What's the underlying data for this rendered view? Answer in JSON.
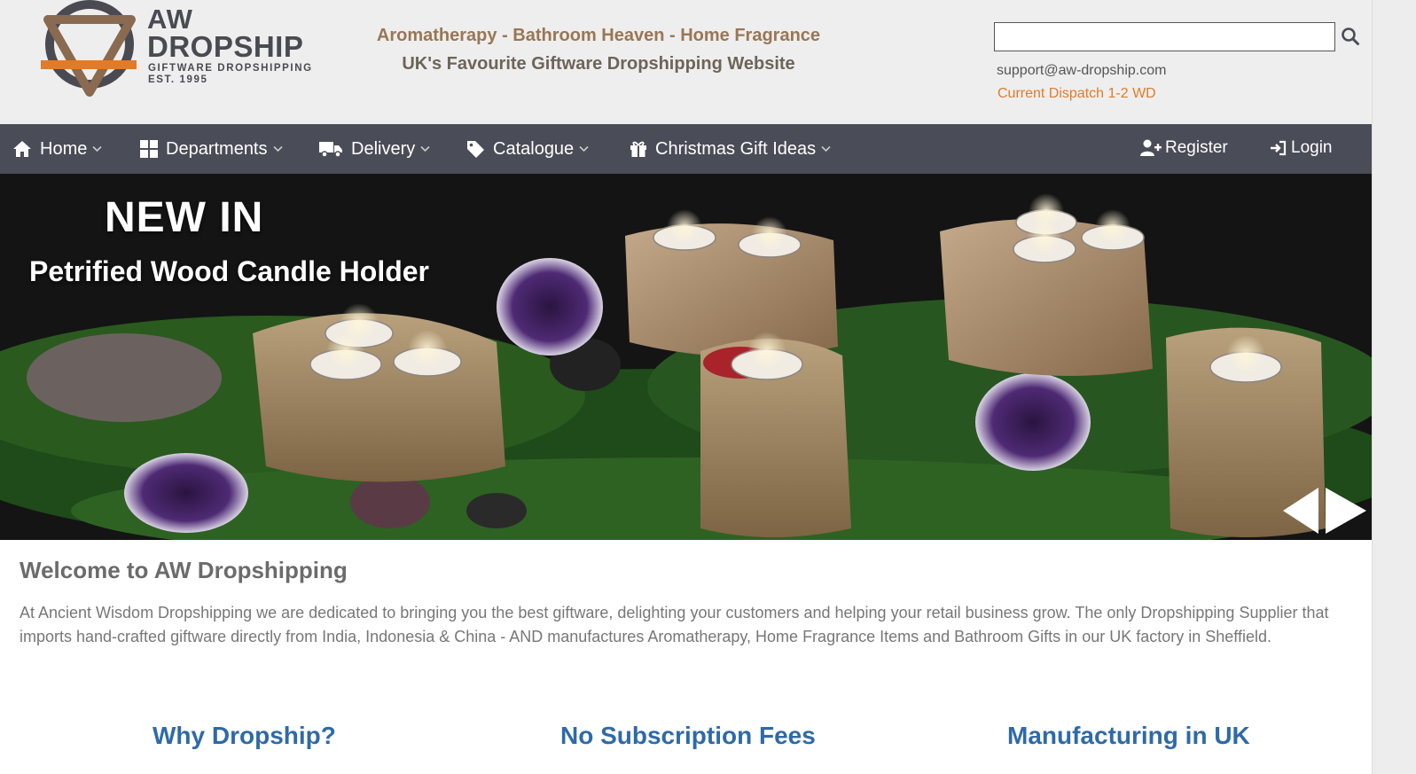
{
  "header": {
    "logo": {
      "line1": "AW",
      "line2": "DROPSHIP",
      "line3": "GIFTWARE DROPSHIPPING",
      "line4": "EST. 1995"
    },
    "tagline_1": "Aromatherapy - Bathroom Heaven - Home Fragrance",
    "tagline_2": "UK's Favourite Giftware Dropshipping Website",
    "search": {
      "value": "",
      "placeholder": ""
    },
    "support_email": "support@aw-dropship.com",
    "dispatch": "Current Dispatch 1-2 WD"
  },
  "nav": {
    "items": [
      {
        "label": "Home",
        "icon": "home-icon"
      },
      {
        "label": "Departments",
        "icon": "grid-icon"
      },
      {
        "label": "Delivery",
        "icon": "truck-icon"
      },
      {
        "label": "Catalogue",
        "icon": "tag-icon"
      },
      {
        "label": "Christmas Gift Ideas",
        "icon": "gift-icon"
      }
    ],
    "register": "Register",
    "login": "Login"
  },
  "banner": {
    "title": "NEW IN",
    "subtitle": "Petrified Wood Candle Holder"
  },
  "content": {
    "welcome_title": "Welcome to AW Dropshipping",
    "welcome_text": "At Ancient Wisdom Dropshipping we are dedicated to bringing you the best giftware, delighting your customers and helping your retail business grow. The only  Dropshipping Supplier that imports hand-crafted giftware directly from India, Indonesia & China - AND manufactures Aromatherapy, Home Fragrance Items and Bathroom Gifts in our UK factory in Sheffield.",
    "features": [
      "Why Dropship?",
      "No Subscription Fees",
      "Manufacturing in UK"
    ]
  },
  "colors": {
    "nav_bg": "#4a4d57",
    "header_bg": "#eeeeee",
    "tagline_gold": "#9a7654",
    "dispatch_orange": "#e07b2a",
    "feature_blue": "#2f6aa8"
  }
}
